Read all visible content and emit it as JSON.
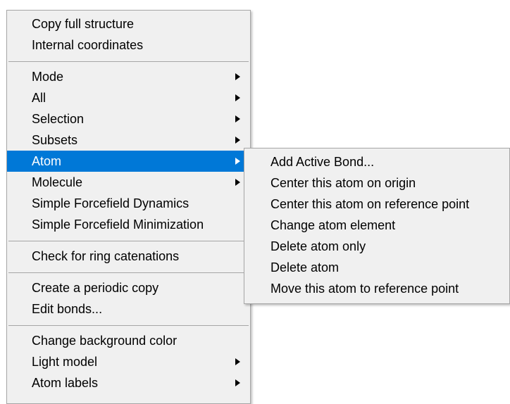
{
  "main_menu": {
    "groups": [
      [
        "Copy full structure",
        "Internal coordinates"
      ],
      [
        "Mode",
        "All",
        "Selection",
        "Subsets",
        "Atom",
        "Molecule",
        "Simple Forcefield Dynamics",
        "Simple Forcefield Minimization"
      ],
      [
        "Check for ring catenations"
      ],
      [
        "Create a periodic copy",
        "Edit bonds..."
      ],
      [
        "Change background color",
        "Light model",
        "Atom labels"
      ]
    ],
    "items": {
      "copy_full_structure": "Copy full structure",
      "internal_coordinates": "Internal coordinates",
      "mode": "Mode",
      "all": "All",
      "selection": "Selection",
      "subsets": "Subsets",
      "atom": "Atom",
      "molecule": "Molecule",
      "simple_forcefield_dynamics": "Simple Forcefield Dynamics",
      "simple_forcefield_minimization": "Simple Forcefield Minimization",
      "check_ring_catenations": "Check for ring catenations",
      "create_periodic_copy": "Create a periodic copy",
      "edit_bonds": "Edit bonds...",
      "change_background_color": "Change background color",
      "light_model": "Light model",
      "atom_labels": "Atom labels"
    },
    "active_item": "Atom"
  },
  "atom_submenu": {
    "items": {
      "add_active_bond": "Add Active Bond...",
      "center_on_origin": "Center this atom on origin",
      "center_on_reference_point": "Center this atom on reference point",
      "change_atom_element": "Change atom element",
      "delete_atom_only": "Delete atom only",
      "delete_atom": "Delete atom",
      "move_to_reference_point": "Move this atom to reference point"
    }
  },
  "colors": {
    "highlight": "#0078d7",
    "menu_background": "#f0f0f0",
    "separator": "#a6a6a6"
  },
  "icons": {
    "submenu_arrow": "triangle-right"
  }
}
